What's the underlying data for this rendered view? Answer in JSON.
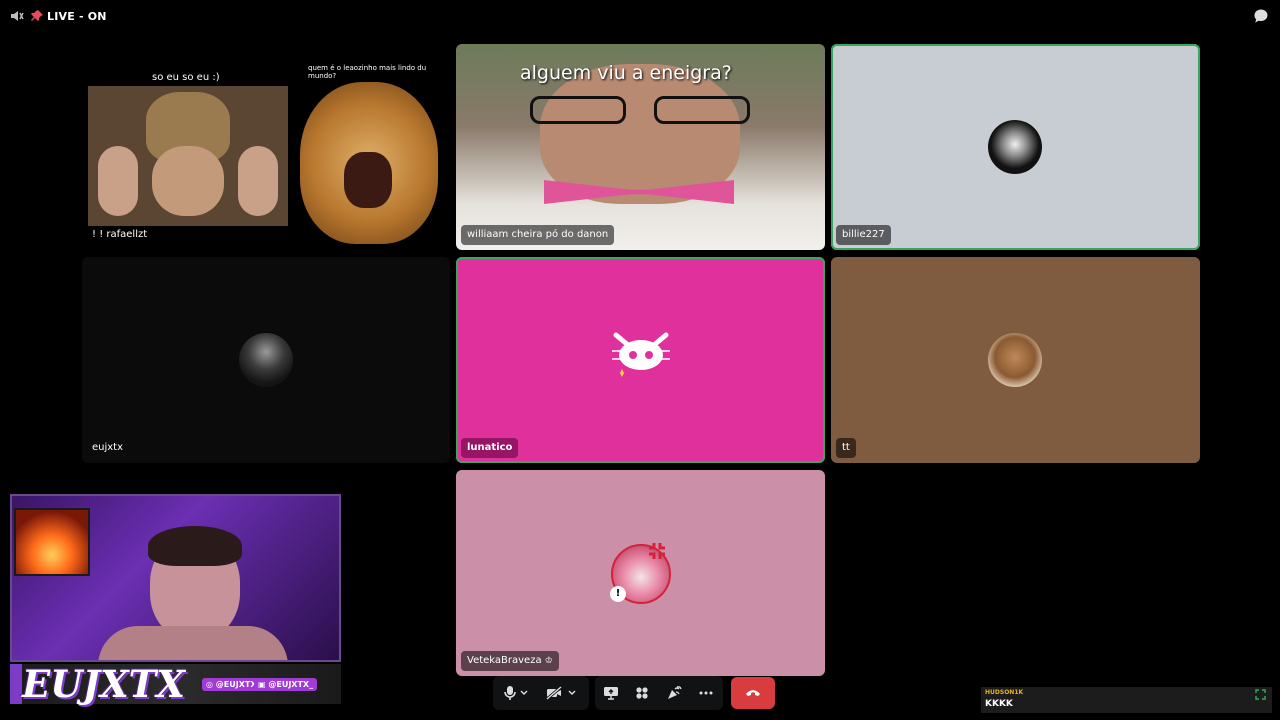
{
  "stream": {
    "title": "LIVE - ON",
    "brand": "EUJXTX",
    "social": [
      "@EUJXTX",
      "@EUJXTX_"
    ]
  },
  "tiles": [
    {
      "label": "! ! rafaellzt",
      "caption_left": "so eu so eu :)",
      "caption_right": "quem é o leaozinho mais lindo du mundo?",
      "bg": "#000000"
    },
    {
      "label": "williaam cheira pó do danon",
      "caption": "alguem viu a eneigra?",
      "bg": "#6f6a5e"
    },
    {
      "label": "billie227",
      "bg": "#c7cdd3",
      "speaking": true
    },
    {
      "label": "eujxtx",
      "bg": "#0b0b0b"
    },
    {
      "label": "lunatico",
      "bg": "#e0309b"
    },
    {
      "label": "tt",
      "bg": "#7f5c3f"
    },
    {
      "label": "VetekaBraveza",
      "bg": "#cc8fa8"
    }
  ],
  "controls": {
    "icons": [
      "microphone-icon",
      "camera-off-icon",
      "screen-share-icon",
      "activities-icon",
      "soundboard-icon",
      "more-icon",
      "hang-up-icon"
    ]
  },
  "chat": {
    "user": "HUDSON1K",
    "message": "KKKK"
  },
  "colors": {
    "accent_purple": "#a23bd6",
    "hangup_red": "#d83c3e",
    "speaking_green": "#3ba55d"
  }
}
